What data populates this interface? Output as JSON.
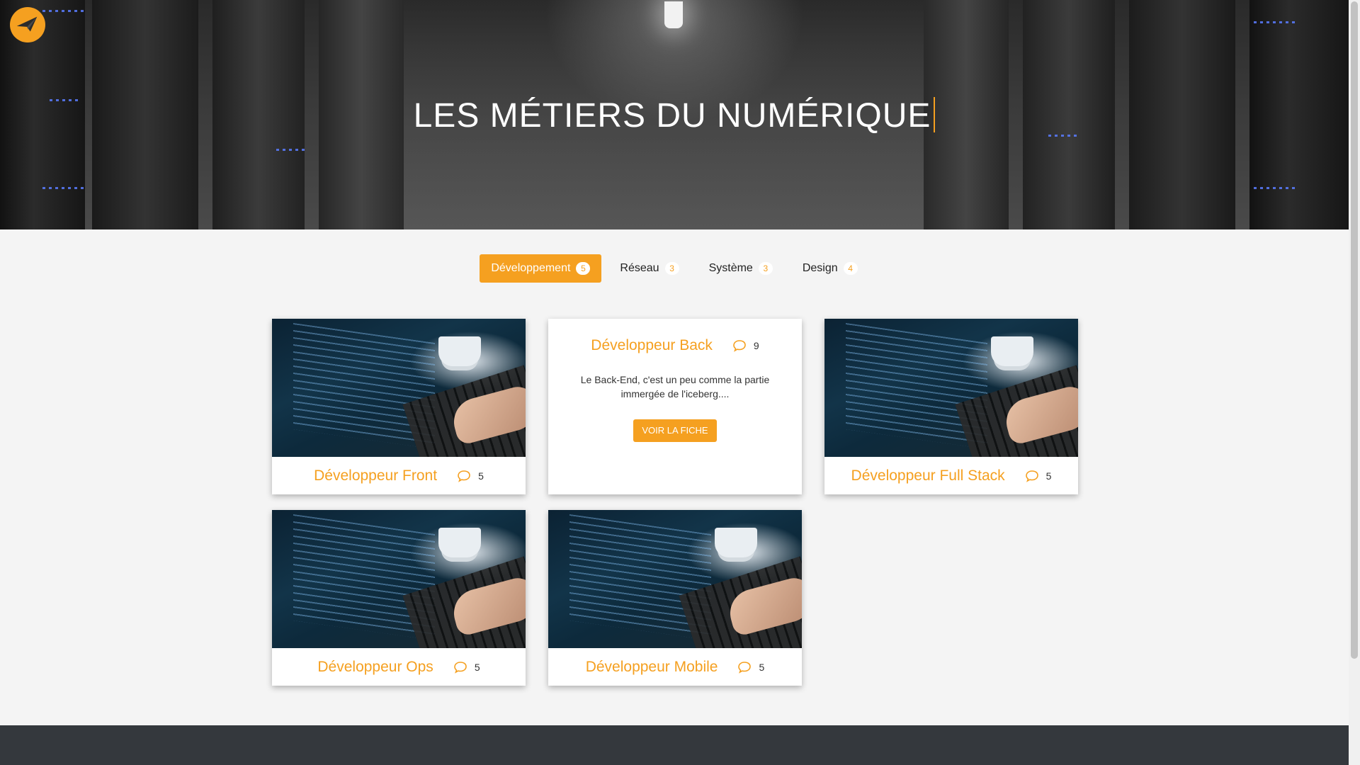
{
  "hero": {
    "title": "LES MÉTIERS DU NUMÉRIQUE",
    "logo": "paper-plane-logo"
  },
  "colors": {
    "accent": "#f5a020",
    "footer": "#34383d"
  },
  "tabs": [
    {
      "label": "Développement",
      "count": "5",
      "active": true
    },
    {
      "label": "Réseau",
      "count": "3",
      "active": false
    },
    {
      "label": "Système",
      "count": "3",
      "active": false
    },
    {
      "label": "Design",
      "count": "4",
      "active": false
    }
  ],
  "cards": [
    {
      "title": "Développeur Front",
      "comments": "5",
      "icon": "comment-icon"
    },
    {
      "title": "Développeur Back",
      "comments": "9",
      "description": "Le Back-End, c'est un peu comme la partie immergée de l'iceberg....",
      "button": "VOIR LA FICHE"
    },
    {
      "title": "Développeur Full Stack",
      "comments": "5"
    },
    {
      "title": "Développeur Ops",
      "comments": "5"
    },
    {
      "title": "Développeur Mobile",
      "comments": "5"
    }
  ]
}
